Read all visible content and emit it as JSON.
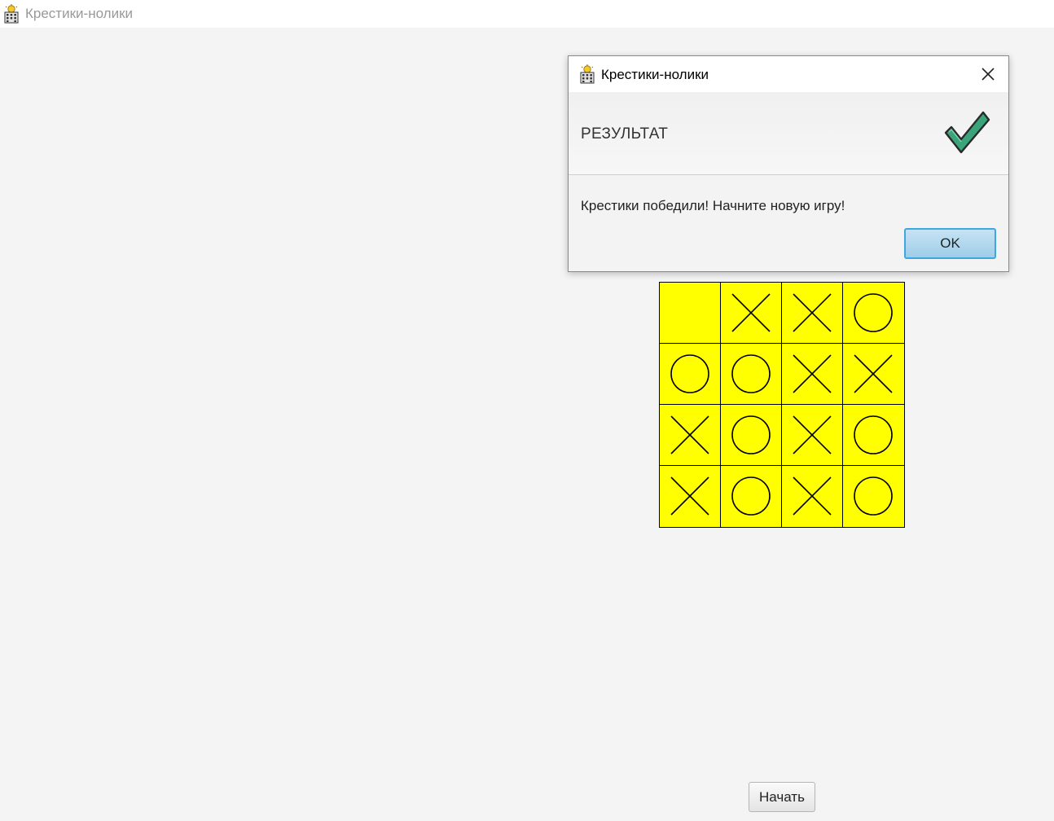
{
  "window": {
    "title": "Крестики-нолики",
    "icon": "app-icon"
  },
  "board": {
    "cells": [
      [
        "",
        "X",
        "X",
        "O"
      ],
      [
        "O",
        "O",
        "X",
        "X"
      ],
      [
        "X",
        "O",
        "X",
        "O"
      ],
      [
        "X",
        "O",
        "X",
        "O"
      ]
    ],
    "cell_color": "#ffff00",
    "line_color": "#000000"
  },
  "start_button": {
    "label": "Начать"
  },
  "dialog": {
    "title": "Крестики-нолики",
    "icon": "app-icon",
    "close_icon": "close-icon",
    "header": "РЕЗУЛЬТАТ",
    "header_icon": "checkmark-icon",
    "message": "Крестики победили! Начните новую игру!",
    "ok_label": "OK",
    "accent_color": "#3fa6de",
    "check_color": "#3aa57a"
  }
}
